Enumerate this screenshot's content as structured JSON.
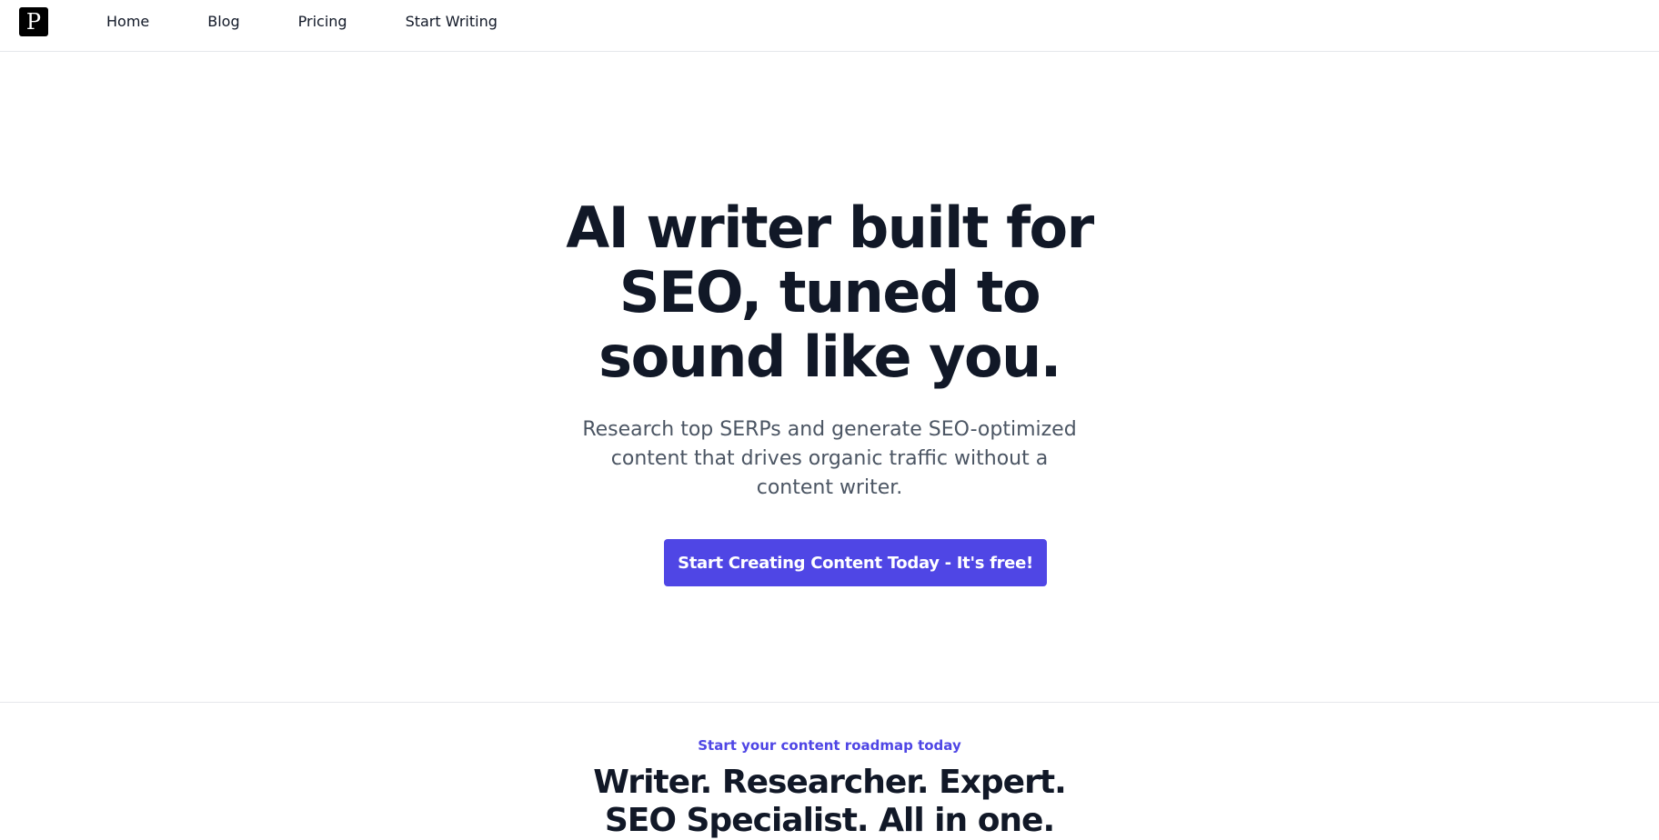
{
  "header": {
    "logo_letter": "P",
    "nav": {
      "home": "Home",
      "blog": "Blog",
      "pricing": "Pricing",
      "start_writing": "Start Writing"
    }
  },
  "hero": {
    "title": "AI writer built for SEO, tuned to sound like you.",
    "subtitle": "Research top SERPs and generate SEO-optimized content that drives organic traffic without a content writer.",
    "cta_label": "Start Creating Content Today - It's free!"
  },
  "roadmap": {
    "eyebrow": "Start your content roadmap today",
    "title": "Writer. Researcher. Expert. SEO Specialist. All in one."
  },
  "colors": {
    "accent": "#4f46e5",
    "heading": "#111827",
    "body_text": "#4b5563",
    "divider": "#e5e7eb"
  }
}
